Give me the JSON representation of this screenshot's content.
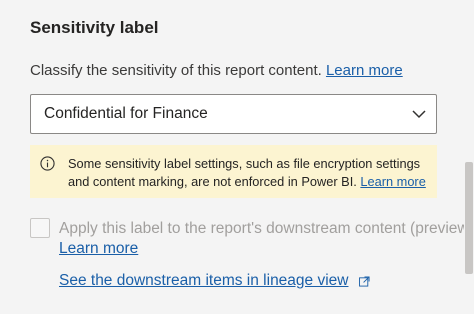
{
  "section": {
    "title": "Sensitivity label",
    "description": "Classify the sensitivity of this report content.",
    "learn_more": "Learn more"
  },
  "dropdown": {
    "selected": "Confidential for Finance",
    "icon": "chevron-down-icon"
  },
  "warning": {
    "text": "Some sensitivity label settings, such as file encryption settings and content marking, are not enforced in Power BI.",
    "learn_more": "Learn more",
    "icon": "info-icon"
  },
  "downstream": {
    "checkbox_checked": false,
    "label": "Apply this label to the report's downstream content (preview)",
    "learn_more": "Learn more",
    "lineage_link": "See the downstream items in lineage view",
    "lineage_icon": "external-link-icon"
  },
  "colors": {
    "link": "#1a5fa8",
    "warning_bg": "#fcf4d1",
    "panel_bg": "#f4f4f4",
    "disabled_text": "#a19f9d"
  }
}
